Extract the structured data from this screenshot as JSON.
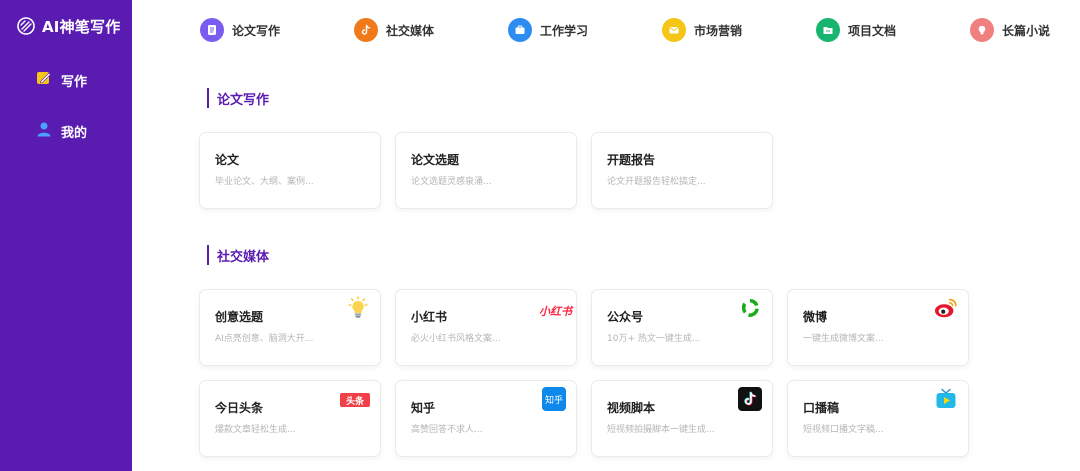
{
  "app": {
    "title": "AI神笔写作"
  },
  "sidebar": {
    "items": [
      {
        "label": "写作",
        "icon": "pencil-note-icon"
      },
      {
        "label": "我的",
        "icon": "user-icon"
      }
    ]
  },
  "categories": [
    {
      "label": "论文写作",
      "icon": "document-icon",
      "color": "#7b5cf0"
    },
    {
      "label": "社交媒体",
      "icon": "tiktok-icon",
      "color": "#f07a1a"
    },
    {
      "label": "工作学习",
      "icon": "briefcase-icon",
      "color": "#2d8cf0"
    },
    {
      "label": "市场营销",
      "icon": "mail-icon",
      "color": "#f5c518"
    },
    {
      "label": "项目文档",
      "icon": "folder-icon",
      "color": "#19b56e"
    },
    {
      "label": "长篇小说",
      "icon": "lightbulb-icon",
      "color": "#f08080"
    }
  ],
  "sections": [
    {
      "title": "论文写作",
      "cards": [
        {
          "title": "论文",
          "desc": "毕业论文、大纲、案例..."
        },
        {
          "title": "论文选题",
          "desc": "论文选题灵感泉涌..."
        },
        {
          "title": "开题报告",
          "desc": "论文开题报告轻松搞定..."
        }
      ]
    },
    {
      "title": "社交媒体",
      "cards": [
        {
          "title": "创意选题",
          "desc": "AI点亮创意、脑洞大开...",
          "icon": "lightbulb-icon"
        },
        {
          "title": "小红书",
          "desc": "必火小红书风格文案...",
          "icon": "xiaohongshu-logo-icon",
          "icon_text": "小红书"
        },
        {
          "title": "公众号",
          "desc": "10万+ 热文一键生成...",
          "icon": "wechat-official-account-icon"
        },
        {
          "title": "微博",
          "desc": "一键生成微博文案...",
          "icon": "weibo-icon"
        },
        {
          "title": "今日头条",
          "desc": "爆款文章轻松生成...",
          "icon": "toutiao-logo-icon",
          "icon_text": "头条"
        },
        {
          "title": "知乎",
          "desc": "高赞回答不求人...",
          "icon": "zhihu-logo-icon",
          "icon_text": "知乎"
        },
        {
          "title": "视频脚本",
          "desc": "短视频拍摄脚本一键生成...",
          "icon": "tiktok-icon"
        },
        {
          "title": "口播稿",
          "desc": "短视频口播文字稿...",
          "icon": "video-play-icon"
        }
      ]
    }
  ],
  "colors": {
    "sidebar_bg": "#5a1bb0",
    "accent": "#5a1bb0"
  }
}
